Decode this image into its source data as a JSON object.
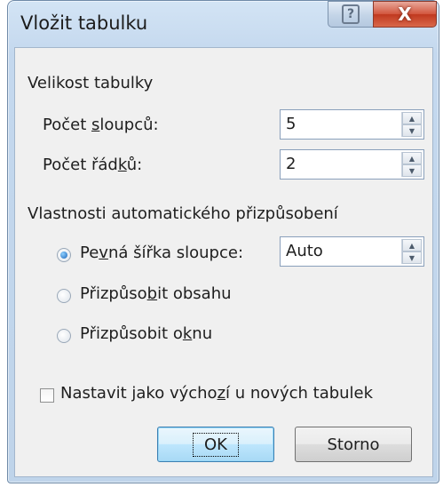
{
  "window": {
    "title": "Vložit tabulku",
    "help_icon": "question-mark-icon",
    "close_icon": "close-x-icon",
    "help_glyph": "?",
    "close_glyph": "X"
  },
  "table_size": {
    "heading": "Velikost tabulky",
    "columns_label_pre": "Počet ",
    "columns_label_mn": "s",
    "columns_label_post": "loupců:",
    "columns_value": "5",
    "rows_label_pre": "Počet řád",
    "rows_label_mn": "k",
    "rows_label_post": "ů:",
    "rows_value": "2"
  },
  "autofit": {
    "heading": "Vlastnosti automatického přizpůsobení",
    "fixed_pre": "Pe",
    "fixed_mn": "v",
    "fixed_post": "ná šířka sloupce:",
    "fixed_value": "Auto",
    "fit_contents_pre": "Přizpůso",
    "fit_contents_mn": "b",
    "fit_contents_post": "it obsahu",
    "fit_window_pre": "Přizpůsobit o",
    "fit_window_mn": "k",
    "fit_window_post": "nu",
    "selected": "fixed"
  },
  "default_checkbox": {
    "pre": "Nastavit jako výcho",
    "mn": "z",
    "post": "í u nových tabulek",
    "checked": false
  },
  "buttons": {
    "ok": "OK",
    "cancel": "Storno"
  },
  "spinner": {
    "up_glyph": "▲",
    "down_glyph": "▼"
  }
}
